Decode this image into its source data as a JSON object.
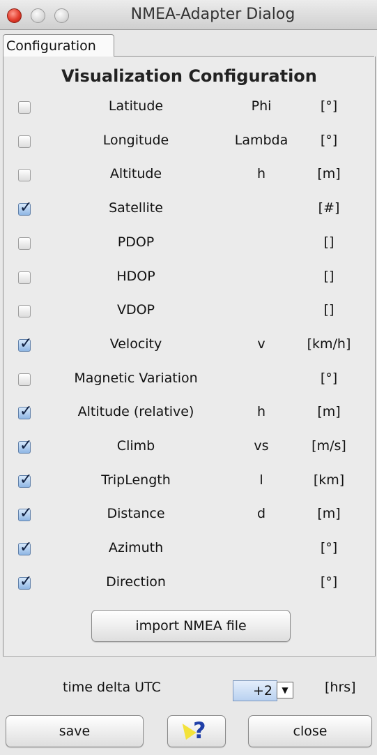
{
  "window": {
    "title": "NMEA-Adapter Dialog"
  },
  "tabs": [
    {
      "label": "Configuration"
    }
  ],
  "section": {
    "title": "Visualization Configuration"
  },
  "rows": [
    {
      "label": "Latitude",
      "symbol": "Phi",
      "unit": "[°]",
      "checked": false
    },
    {
      "label": "Longitude",
      "symbol": "Lambda",
      "unit": "[°]",
      "checked": false
    },
    {
      "label": "Altitude",
      "symbol": "h",
      "unit": "[m]",
      "checked": false
    },
    {
      "label": "Satellite",
      "symbol": "",
      "unit": "[#]",
      "checked": true
    },
    {
      "label": "PDOP",
      "symbol": "",
      "unit": "[]",
      "checked": false
    },
    {
      "label": "HDOP",
      "symbol": "",
      "unit": "[]",
      "checked": false
    },
    {
      "label": "VDOP",
      "symbol": "",
      "unit": "[]",
      "checked": false
    },
    {
      "label": "Velocity",
      "symbol": "v",
      "unit": "[km/h]",
      "checked": true
    },
    {
      "label": "Magnetic Variation",
      "symbol": "",
      "unit": "[°]",
      "checked": false
    },
    {
      "label": "Altitude (relative)",
      "symbol": "h",
      "unit": "[m]",
      "checked": true
    },
    {
      "label": "Climb",
      "symbol": "vs",
      "unit": "[m/s]",
      "checked": true
    },
    {
      "label": "TripLength",
      "symbol": "l",
      "unit": "[km]",
      "checked": true
    },
    {
      "label": "Distance",
      "symbol": "d",
      "unit": "[m]",
      "checked": true
    },
    {
      "label": "Azimuth",
      "symbol": "",
      "unit": "[°]",
      "checked": true
    },
    {
      "label": "Direction",
      "symbol": "",
      "unit": "[°]",
      "checked": true
    }
  ],
  "import_button": "import NMEA file",
  "utc": {
    "label": "time delta UTC",
    "value": "+2",
    "unit": "[hrs]"
  },
  "buttons": {
    "save": "save",
    "close": "close",
    "help_icon": "help-pointer-icon"
  },
  "colors": {
    "checkbox_on": "#8fb6e4",
    "close_light": "#e23c2c",
    "help_question": "#1f3fa8"
  }
}
